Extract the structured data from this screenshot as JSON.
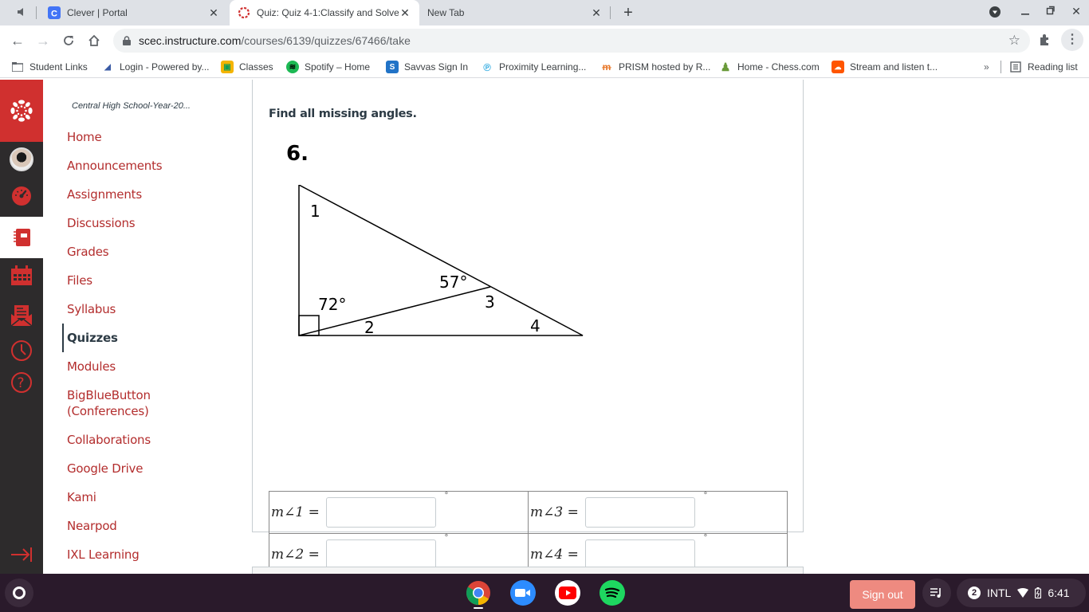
{
  "browser": {
    "tabs": [
      {
        "title": "Clever | Portal",
        "favicon": "clever-icon",
        "active": false
      },
      {
        "title": "Quiz: Quiz 4-1:Classify and Solve",
        "favicon": "canvas-icon",
        "active": true
      },
      {
        "title": "New Tab",
        "favicon": "none",
        "active": false
      }
    ],
    "url_host": "scec.instructure.com",
    "url_path": "/courses/6139/quizzes/67466/take",
    "bookmarks": [
      {
        "label": "Student Links",
        "icon": "folder-icon"
      },
      {
        "label": "Login - Powered by...",
        "icon": "login-icon"
      },
      {
        "label": "Classes",
        "icon": "classroom-icon"
      },
      {
        "label": "Spotify – Home",
        "icon": "spotify-icon"
      },
      {
        "label": "Savvas Sign In",
        "icon": "savvas-icon"
      },
      {
        "label": "Proximity Learning...",
        "icon": "proximity-icon"
      },
      {
        "label": "PRISM hosted by R...",
        "icon": "prism-icon"
      },
      {
        "label": "Home - Chess.com",
        "icon": "chess-icon"
      },
      {
        "label": "Stream and listen t...",
        "icon": "soundcloud-icon"
      }
    ],
    "overflow_label": "»",
    "reading_list_label": "Reading list"
  },
  "global_nav": {
    "items": [
      "canvas-logo",
      "account",
      "dashboard",
      "courses",
      "calendar",
      "inbox",
      "history",
      "help"
    ],
    "collapse": "collapse-nav"
  },
  "course_nav": {
    "course_title": "Central High School-Year-20...",
    "items": [
      {
        "label": "Home"
      },
      {
        "label": "Announcements"
      },
      {
        "label": "Assignments"
      },
      {
        "label": "Discussions"
      },
      {
        "label": "Grades"
      },
      {
        "label": "Files"
      },
      {
        "label": "Syllabus"
      },
      {
        "label": "Quizzes",
        "active": true
      },
      {
        "label": "Modules"
      },
      {
        "label": "BigBlueButton (Conferences)"
      },
      {
        "label": "Collaborations"
      },
      {
        "label": "Google Drive"
      },
      {
        "label": "Kami"
      },
      {
        "label": "Nearpod"
      },
      {
        "label": "IXL Learning"
      }
    ]
  },
  "question": {
    "prompt": "Find all missing angles.",
    "number": "6.",
    "figure": {
      "angle_labels": [
        "1",
        "2",
        "3",
        "4"
      ],
      "given_angles": [
        "72°",
        "57°"
      ]
    },
    "answers": [
      {
        "label": "m∠1 =",
        "value": "",
        "unit": "°"
      },
      {
        "label": "m∠3 =",
        "value": "",
        "unit": "°"
      },
      {
        "label": "m∠2 =",
        "value": "",
        "unit": "°"
      },
      {
        "label": "m∠4 =",
        "value": "",
        "unit": "°"
      }
    ]
  },
  "shelf": {
    "apps": [
      "chrome",
      "zoom",
      "youtube",
      "spotify"
    ],
    "sign_out_label": "Sign out",
    "notification_count": "2",
    "input_method": "INTL",
    "time": "6:41"
  },
  "colors": {
    "canvas_red": "#d0302f",
    "nav_link": "#b32d2d",
    "global_nav_bg": "#2d2b2c",
    "shelf_bg": "#2a1a2b",
    "sign_out_bg": "#ee8a80"
  }
}
